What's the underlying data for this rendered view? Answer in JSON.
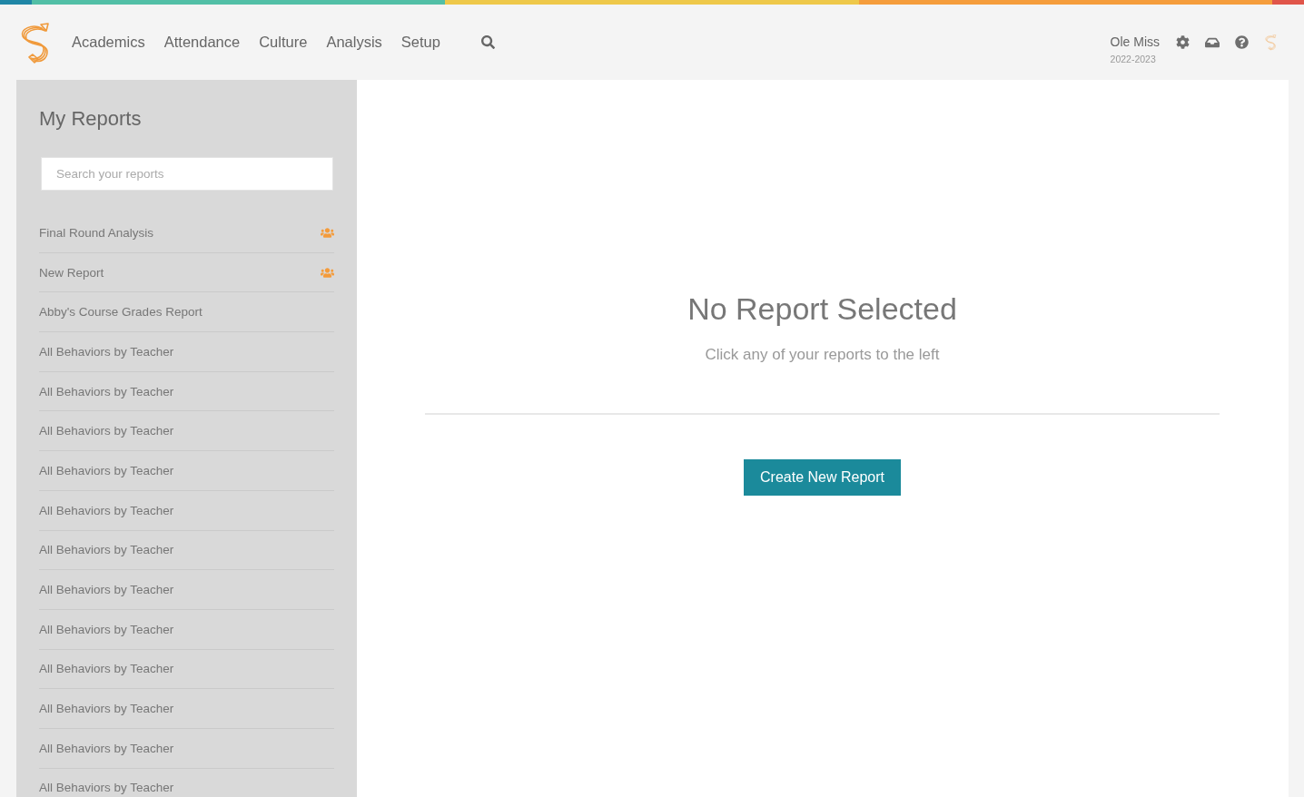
{
  "header": {
    "nav": [
      {
        "label": "Academics"
      },
      {
        "label": "Attendance"
      },
      {
        "label": "Culture"
      },
      {
        "label": "Analysis"
      },
      {
        "label": "Setup"
      }
    ],
    "school": {
      "name": "Ole Miss",
      "year": "2022-2023"
    }
  },
  "sidebar": {
    "title": "My Reports",
    "search": {
      "placeholder": "Search your reports"
    },
    "reports": [
      {
        "name": "Final Round Analysis",
        "shared": true
      },
      {
        "name": "New Report",
        "shared": true
      },
      {
        "name": "Abby's Course Grades Report",
        "shared": false
      },
      {
        "name": "All Behaviors by Teacher",
        "shared": false
      },
      {
        "name": "All Behaviors by Teacher",
        "shared": false
      },
      {
        "name": "All Behaviors by Teacher",
        "shared": false
      },
      {
        "name": "All Behaviors by Teacher",
        "shared": false
      },
      {
        "name": "All Behaviors by Teacher",
        "shared": false
      },
      {
        "name": "All Behaviors by Teacher",
        "shared": false
      },
      {
        "name": "All Behaviors by Teacher",
        "shared": false
      },
      {
        "name": "All Behaviors by Teacher",
        "shared": false
      },
      {
        "name": "All Behaviors by Teacher",
        "shared": false
      },
      {
        "name": "All Behaviors by Teacher",
        "shared": false
      },
      {
        "name": "All Behaviors by Teacher",
        "shared": false
      },
      {
        "name": "All Behaviors by Teacher",
        "shared": false
      }
    ]
  },
  "main": {
    "title": "No Report Selected",
    "subtitle": "Click any of your reports to the left",
    "button": "Create New Report"
  }
}
